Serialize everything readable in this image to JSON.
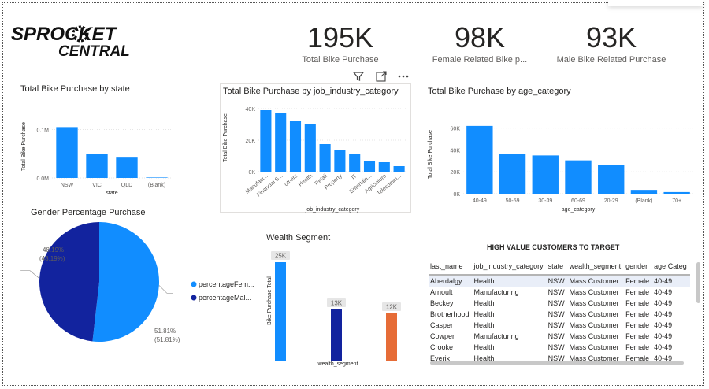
{
  "logo": {
    "line1": "SPROCKET",
    "line2": "CENTRAL"
  },
  "kpis": [
    {
      "value": "195K",
      "label": "Total Bike Purchase"
    },
    {
      "value": "98K",
      "label": "Female Related Bike p..."
    },
    {
      "value": "93K",
      "label": "Male Bike Related Purchase"
    }
  ],
  "visual_header_icons": [
    "filter-icon",
    "focus-mode-icon",
    "more-options-icon"
  ],
  "colors": {
    "blue": "#118dff",
    "navy": "#12239e",
    "orange": "#e66c37"
  },
  "chart_data": [
    {
      "type": "bar",
      "title": "Total Bike Purchase by state",
      "xlabel": "state",
      "ylabel": "Total Bike Purchase",
      "yticks": [
        "0.0M",
        "0.1M"
      ],
      "categories": [
        "NSW",
        "VIC",
        "QLD",
        "(Blank)"
      ],
      "values": [
        105000,
        49000,
        42000,
        1000
      ],
      "ylim": [
        0,
        130000
      ]
    },
    {
      "type": "bar",
      "title": "Total Bike Purchase by job_industry_category",
      "xlabel": "job_industry_category",
      "ylabel": "Total Bike Purchase",
      "yticks": [
        "0K",
        "20K",
        "40K"
      ],
      "categories": [
        "Manufact...",
        "Financial S...",
        "others",
        "Health",
        "Retail",
        "Property",
        "IT",
        "Entertain...",
        "Agriculture",
        "Telecomm..."
      ],
      "values": [
        39000,
        37000,
        32000,
        30000,
        17500,
        14000,
        11000,
        7000,
        6000,
        3500
      ],
      "ylim": [
        0,
        43000
      ]
    },
    {
      "type": "bar",
      "title": "Total Bike Purchase by age_category",
      "xlabel": "age_category",
      "ylabel": "Total Bike Purchase",
      "yticks": [
        "0K",
        "20K",
        "40K",
        "60K"
      ],
      "categories": [
        "40-49",
        "50-59",
        "30-39",
        "60-69",
        "20-29",
        "(Blank)",
        "70+"
      ],
      "values": [
        62000,
        36000,
        35000,
        30500,
        26000,
        3500,
        1500
      ],
      "ylim": [
        0,
        72000
      ]
    },
    {
      "type": "pie",
      "title": "Gender Percentage Purchase",
      "series": [
        {
          "name": "percentageFem...",
          "value": 51.81,
          "label1": "51.81%",
          "label2": "(51.81%)"
        },
        {
          "name": "percentageMal...",
          "value": 48.19,
          "label1": "48.19%",
          "label2": "(48.19%)"
        }
      ]
    },
    {
      "type": "bar",
      "title": "Wealth Segment",
      "xlabel": "wealth_segment",
      "ylabel": "Bike Purchase Total",
      "values": [
        25000,
        13000,
        12000
      ],
      "data_labels": [
        "25K",
        "13K",
        "12K"
      ]
    }
  ],
  "table": {
    "title": "HIGH VALUE CUSTOMERS TO TARGET",
    "columns": [
      "last_name",
      "job_industry_category",
      "state",
      "wealth_segment",
      "gender",
      "age Categ"
    ],
    "rows": [
      [
        "Aberdalgy",
        "Health",
        "NSW",
        "Mass Customer",
        "Female",
        "40-49"
      ],
      [
        "Arnoult",
        "Manufacturing",
        "NSW",
        "Mass Customer",
        "Female",
        "40-49"
      ],
      [
        "Beckey",
        "Health",
        "NSW",
        "Mass Customer",
        "Female",
        "40-49"
      ],
      [
        "Brotherhood",
        "Health",
        "NSW",
        "Mass Customer",
        "Female",
        "40-49"
      ],
      [
        "Casper",
        "Health",
        "NSW",
        "Mass Customer",
        "Female",
        "40-49"
      ],
      [
        "Cowper",
        "Manufacturing",
        "NSW",
        "Mass Customer",
        "Female",
        "40-49"
      ],
      [
        "Crooke",
        "Health",
        "NSW",
        "Mass Customer",
        "Female",
        "40-49"
      ],
      [
        "Everix",
        "Health",
        "NSW",
        "Mass Customer",
        "Female",
        "40-49"
      ]
    ]
  }
}
